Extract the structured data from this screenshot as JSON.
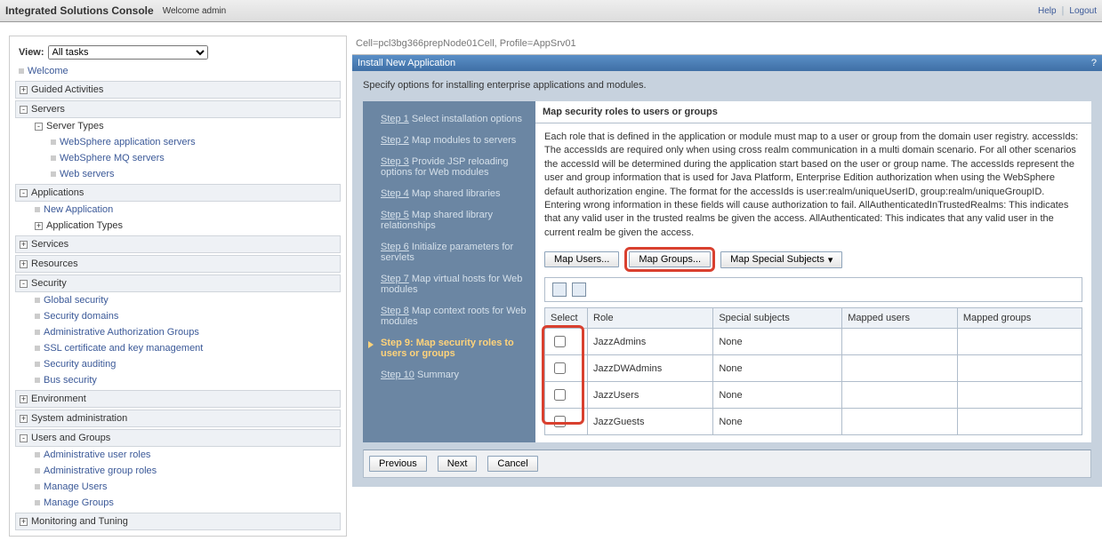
{
  "topbar": {
    "title": "Integrated Solutions Console",
    "welcome": "Welcome admin",
    "help": "Help",
    "logout": "Logout"
  },
  "sidebar": {
    "view_label": "View:",
    "view_value": "All tasks",
    "welcome": "Welcome",
    "sections": {
      "guided": "Guided Activities",
      "servers": "Servers",
      "server_types": "Server Types",
      "leaves_servers": [
        "WebSphere application servers",
        "WebSphere MQ servers",
        "Web servers"
      ],
      "applications": "Applications",
      "new_app": "New Application",
      "app_types": "Application Types",
      "services": "Services",
      "resources": "Resources",
      "security": "Security",
      "leaves_security": [
        "Global security",
        "Security domains",
        "Administrative Authorization Groups",
        "SSL certificate and key management",
        "Security auditing",
        "Bus security"
      ],
      "environment": "Environment",
      "sysadmin": "System administration",
      "usersgroups": "Users and Groups",
      "leaves_ug": [
        "Administrative user roles",
        "Administrative group roles",
        "Manage Users",
        "Manage Groups"
      ],
      "monitoring": "Monitoring and Tuning"
    }
  },
  "main": {
    "breadcrumb": "Cell=pcl3bg366prepNode01Cell, Profile=AppSrv01",
    "panel_title": "Install New Application",
    "spec": "Specify options for installing enterprise applications and modules.",
    "steps": [
      {
        "num": "Step 1",
        "rest": "  Select installation options"
      },
      {
        "num": "Step 2",
        "rest": "  Map modules to servers"
      },
      {
        "num": "Step 3",
        "rest": "  Provide JSP reloading options for Web modules"
      },
      {
        "num": "Step 4",
        "rest": "  Map shared libraries"
      },
      {
        "num": "Step 5",
        "rest": "  Map shared library relationships"
      },
      {
        "num": "Step 6",
        "rest": "  Initialize parameters for servlets"
      },
      {
        "num": "Step 7",
        "rest": "  Map virtual hosts for Web modules"
      },
      {
        "num": "Step 8",
        "rest": "  Map context roots for Web modules"
      },
      {
        "num": "Step 9:",
        "rest": " Map security roles to users or groups",
        "active": true
      },
      {
        "num": "Step 10",
        "rest": "  Summary"
      }
    ],
    "content_head": "Map security roles to users or groups",
    "desc": "Each role that is defined in the application or module must map to a user or group from the domain user registry. accessIds: The accessIds are required only when using cross realm communication in a multi domain scenario. For all other scenarios the accessId will be determined during the application start based on the user or group name. The accessIds represent the user and group information that is used for Java Platform, Enterprise Edition authorization when using the WebSphere default authorization engine. The format for the accessIds is user:realm/uniqueUserID, group:realm/uniqueGroupID. Entering wrong information in these fields will cause authorization to fail. AllAuthenticatedInTrustedRealms: This indicates that any valid user in the trusted realms be given the access. AllAuthenticated: This indicates that any valid user in the current realm be given the access.",
    "buttons": {
      "map_users": "Map Users...",
      "map_groups": "Map Groups...",
      "map_special": "Map Special Subjects"
    },
    "columns": [
      "Select",
      "Role",
      "Special subjects",
      "Mapped users",
      "Mapped groups"
    ],
    "rows": [
      {
        "role": "JazzAdmins",
        "special": "None",
        "users": "",
        "groups": ""
      },
      {
        "role": "JazzDWAdmins",
        "special": "None",
        "users": "",
        "groups": ""
      },
      {
        "role": "JazzUsers",
        "special": "None",
        "users": "",
        "groups": ""
      },
      {
        "role": "JazzGuests",
        "special": "None",
        "users": "",
        "groups": ""
      }
    ],
    "bottom": {
      "prev": "Previous",
      "next": "Next",
      "cancel": "Cancel"
    }
  }
}
